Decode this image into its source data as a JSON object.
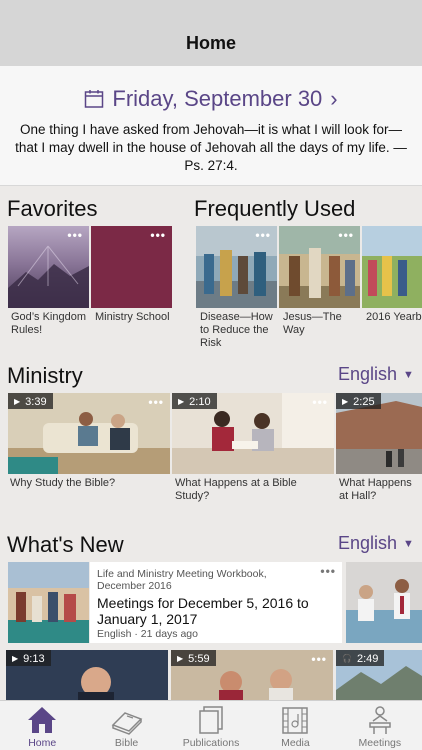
{
  "nav": {
    "title": "Home"
  },
  "daily_text": {
    "date": "Friday, September 30",
    "scripture": "One thing I have asked from Jehovah—it is what I will look for—that I may dwell in the house of Jehovah all the days of my life. —Ps. 27:4."
  },
  "favorites": {
    "title": "Favorites",
    "items": [
      {
        "label": "God’s Kingdom Rules!",
        "color": "#7d6a8a"
      },
      {
        "label": "Ministry School",
        "color": "#7b2946"
      }
    ]
  },
  "frequently_used": {
    "title": "Frequently Used",
    "items": [
      {
        "label": "Disease—How to Reduce the Risk"
      },
      {
        "label": "Jesus—The Way"
      },
      {
        "label": "2016 Yearb"
      }
    ]
  },
  "ministry": {
    "title": "Ministry",
    "language": "English",
    "videos": [
      {
        "duration": "3:39",
        "label": "Why Study the Bible?"
      },
      {
        "duration": "2:10",
        "label": "What Happens at a Bible Study?"
      },
      {
        "duration": "2:25",
        "label": "What Happens at Hall?"
      }
    ]
  },
  "whats_new": {
    "title": "What's New",
    "language": "English",
    "featured": {
      "meta": "Life and Ministry Meeting Workbook, December 2016",
      "headline": "Meetings for December 5, 2016 to January 1, 2017",
      "sub": "English · 21 days ago"
    },
    "videos": [
      {
        "duration": "9:13",
        "kind": "video"
      },
      {
        "duration": "5:59",
        "kind": "video"
      },
      {
        "duration": "2:49",
        "kind": "audio"
      }
    ]
  },
  "tabbar": {
    "tabs": [
      {
        "label": "Home",
        "icon": "home-icon",
        "active": true
      },
      {
        "label": "Bible",
        "icon": "bible-icon"
      },
      {
        "label": "Publications",
        "icon": "publications-icon"
      },
      {
        "label": "Media",
        "icon": "media-icon"
      },
      {
        "label": "Meetings",
        "icon": "meetings-icon"
      }
    ]
  },
  "colors": {
    "accent": "#5a4687",
    "navbar": "#d6d6d6",
    "background": "#eceae8"
  }
}
